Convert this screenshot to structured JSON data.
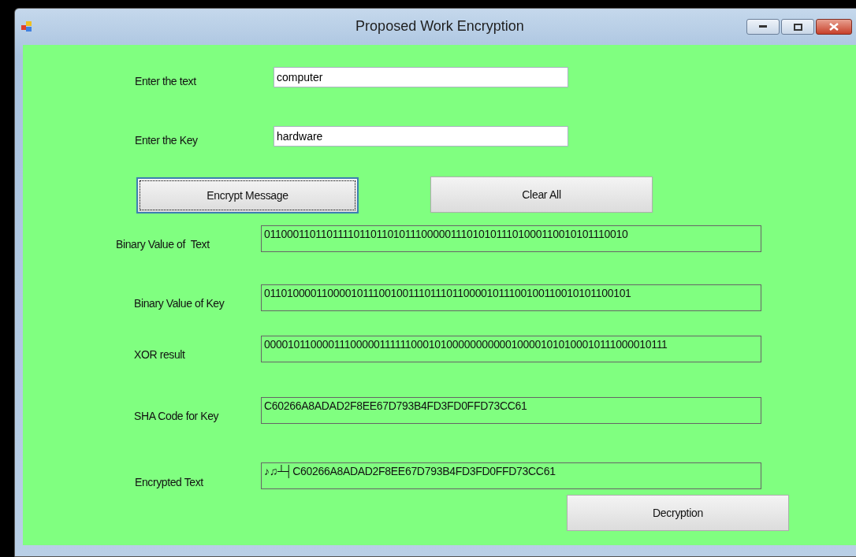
{
  "window": {
    "title": "Proposed Work Encryption"
  },
  "inputs": [
    {
      "label": "Enter the text",
      "value": "computer"
    },
    {
      "label": "Enter the Key",
      "value": "hardware"
    }
  ],
  "buttons": [
    {
      "label": "Encrypt Message",
      "focused": true
    },
    {
      "label": "Clear All",
      "focused": false
    },
    {
      "label": "Decryption",
      "focused": false
    }
  ],
  "outputs": [
    {
      "label": "Binary Value of  Text",
      "value": "0110001101101111011011010111000001110101011101000110010101110010"
    },
    {
      "label": "Binary Value of Key",
      "value": "0110100001100001011100100111011101100001011100100110010101100101"
    },
    {
      "label": "XOR result",
      "value": "0000101100001110000011111100010100000000000100001010100010111000010111"
    },
    {
      "label": "SHA Code for Key",
      "value": "C60266A8ADAD2F8EE67D793B4FD3FD0FFD73CC61"
    },
    {
      "label": "Encrypted Text",
      "value": "♪♫┴┤C60266A8ADAD2F8EE67D793B4FD3FD0FFD73CC61"
    }
  ]
}
